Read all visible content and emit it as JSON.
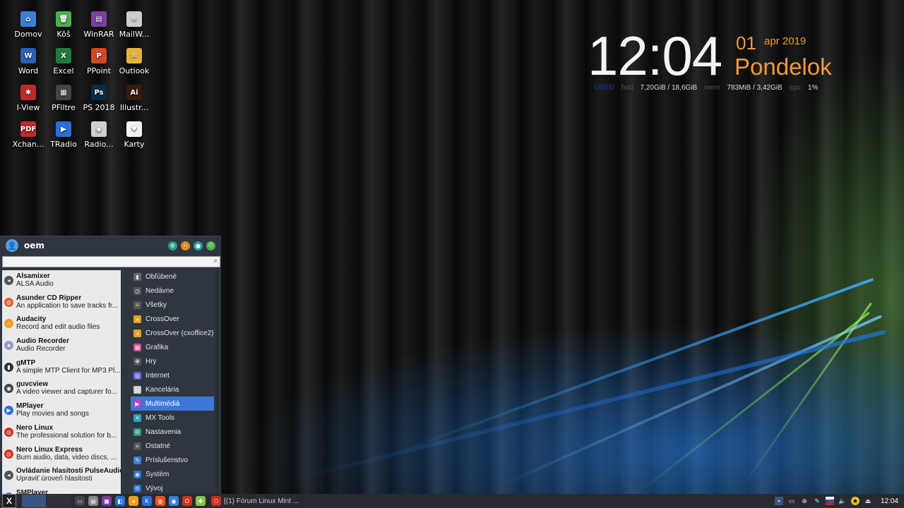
{
  "desktop_icons": [
    {
      "label": "Domov",
      "icon": "home-folder-icon",
      "color": "#3d7fd6",
      "glyph": "⌂"
    },
    {
      "label": "Kôš",
      "icon": "trash-icon",
      "color": "#4caf50",
      "glyph": "🗑"
    },
    {
      "label": "WinRAR",
      "icon": "winrar-icon",
      "color": "#7a3fa0",
      "glyph": "▤"
    },
    {
      "label": "MailW...",
      "icon": "mail-icon",
      "color": "#cccccc",
      "glyph": "❄"
    },
    {
      "label": "Word",
      "icon": "word-icon",
      "color": "#2b5fb8",
      "glyph": "W"
    },
    {
      "label": "Excel",
      "icon": "excel-icon",
      "color": "#1e7b3c",
      "glyph": "X"
    },
    {
      "label": "PPoint",
      "icon": "powerpoint-icon",
      "color": "#d24726",
      "glyph": "P"
    },
    {
      "label": "Outlook",
      "icon": "outlook-icon",
      "color": "#e8b23a",
      "glyph": "✉"
    },
    {
      "label": "I-View",
      "icon": "irfanview-icon",
      "color": "#c0282a",
      "glyph": "✱"
    },
    {
      "label": "PFiltre",
      "icon": "pfiltre-icon",
      "color": "#444444",
      "glyph": "▦"
    },
    {
      "label": "PS 2018",
      "icon": "photoshop-icon",
      "color": "#0b2b45",
      "glyph": "Ps"
    },
    {
      "label": "Illustr...",
      "icon": "illustrator-icon",
      "color": "#3a1a0a",
      "glyph": "Ai"
    },
    {
      "label": "Xchan...",
      "icon": "pdf-xchange-icon",
      "color": "#c0282a",
      "glyph": "PDF"
    },
    {
      "label": "TRadio",
      "icon": "tradio-icon",
      "color": "#2a6fd6",
      "glyph": "▶"
    },
    {
      "label": "Radio...",
      "icon": "radio-icon",
      "color": "#cfcfcf",
      "glyph": "◉"
    },
    {
      "label": "Karty",
      "icon": "cards-icon",
      "color": "#f2f2f2",
      "glyph": "♥"
    }
  ],
  "clock": {
    "time": "12:04",
    "day": "01",
    "month_year": "apr 2019",
    "weekday": "Pondelok"
  },
  "stats": {
    "used": "USED",
    "hdd_label": "hdd",
    "hdd_value": "7,20GiB / 18,6GiB",
    "mem_label": "mem",
    "mem_value": "783MiB / 3,42GiB",
    "cpu_label": "cpu",
    "cpu_value": "1%"
  },
  "menu": {
    "username": "oem",
    "search_placeholder": "",
    "apps": [
      {
        "name": "Alsamixer",
        "desc": "ALSA Audio",
        "color": "#555555",
        "glyph": "◂"
      },
      {
        "name": "Asunder CD Ripper",
        "desc": "An application to save tracks fr...",
        "color": "#e06030",
        "glyph": "◎"
      },
      {
        "name": "Audacity",
        "desc": "Record and edit audio files",
        "color": "#e8a020",
        "glyph": "∩"
      },
      {
        "name": "Audio Recorder",
        "desc": "Audio Recorder",
        "color": "#9999cc",
        "glyph": "●"
      },
      {
        "name": "gMTP",
        "desc": "A simple MTP Client for MP3 Pl...",
        "color": "#333333",
        "glyph": "▮"
      },
      {
        "name": "guvcview",
        "desc": "A video viewer and capturer fo...",
        "color": "#444444",
        "glyph": "◉"
      },
      {
        "name": "MPlayer",
        "desc": "Play movies and songs",
        "color": "#2a6fd6",
        "glyph": "▶"
      },
      {
        "name": "Nero Linux",
        "desc": "The professional solution for b...",
        "color": "#d03020",
        "glyph": "◎"
      },
      {
        "name": "Nero Linux Express",
        "desc": "Burn audio, data, video discs, ...",
        "color": "#d03020",
        "glyph": "◎"
      },
      {
        "name": "Ovládanie hlasitosti PulseAudio",
        "desc": "Upraviť úroveň hlasitosti",
        "color": "#555555",
        "glyph": "◂"
      },
      {
        "name": "SMPlayer",
        "desc": "",
        "color": "#2a6fd6",
        "glyph": "▶"
      }
    ],
    "categories": [
      {
        "label": "Obľúbené",
        "icon": "bookmark-icon",
        "color": "#666666",
        "glyph": "▮"
      },
      {
        "label": "Nedávne",
        "icon": "clock-icon",
        "color": "#555555",
        "glyph": "◷"
      },
      {
        "label": "Všetky",
        "icon": "list-icon",
        "color": "#555555",
        "glyph": "≡"
      },
      {
        "label": "CrossOver",
        "icon": "crossover-icon",
        "color": "#e8a020",
        "glyph": "◕"
      },
      {
        "label": "CrossOver (cxoffice2)",
        "icon": "crossover-icon",
        "color": "#e8a020",
        "glyph": "◕"
      },
      {
        "label": "Grafika",
        "icon": "graphics-icon",
        "color": "#d94a8c",
        "glyph": "▦"
      },
      {
        "label": "Hry",
        "icon": "gamepad-icon",
        "color": "#555555",
        "glyph": "✤"
      },
      {
        "label": "Internet",
        "icon": "globe-icon",
        "color": "#6c5fd6",
        "glyph": "◍"
      },
      {
        "label": "Kancelária",
        "icon": "document-icon",
        "color": "#cccccc",
        "glyph": "▤"
      },
      {
        "label": "Multimédiá",
        "icon": "media-icon",
        "color": "#c040c0",
        "glyph": "▶"
      },
      {
        "label": "MX Tools",
        "icon": "mx-tools-icon",
        "color": "#2aa0c0",
        "glyph": "✕"
      },
      {
        "label": "Nastavenia",
        "icon": "settings-icon",
        "color": "#2aa080",
        "glyph": "⚙"
      },
      {
        "label": "Ostatné",
        "icon": "other-icon",
        "color": "#555555",
        "glyph": "≡"
      },
      {
        "label": "Príslušenstvo",
        "icon": "accessories-icon",
        "color": "#3d7fd6",
        "glyph": "✎"
      },
      {
        "label": "Systém",
        "icon": "system-icon",
        "color": "#2a6fd6",
        "glyph": "◉"
      },
      {
        "label": "Vývoj",
        "icon": "development-icon",
        "color": "#2a6fd6",
        "glyph": "⚙"
      }
    ],
    "active_category_index": 9
  },
  "taskbar": {
    "start_glyph": "X",
    "task_title": "[(1) Fórum Linux Mint ...",
    "time": "12:04"
  }
}
